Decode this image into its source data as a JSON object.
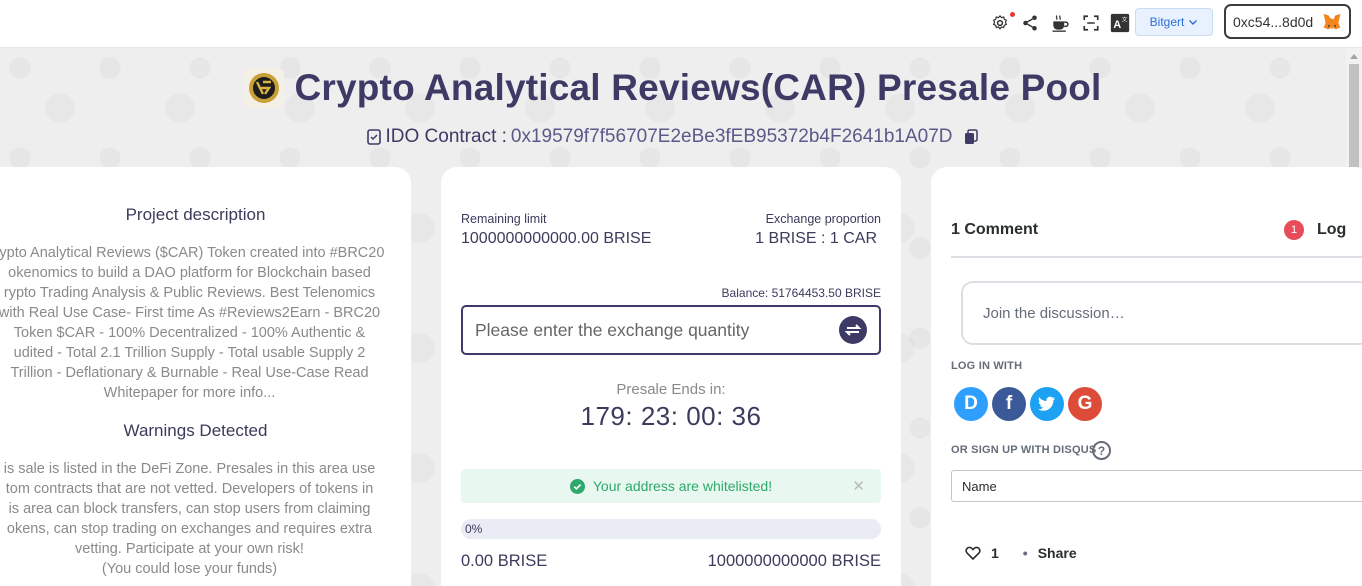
{
  "topbar": {
    "network_label": "Bitgert",
    "wallet_address": "0xc54...8d0d"
  },
  "header": {
    "title": "Crypto Analytical Reviews(CAR) Presale Pool",
    "contract_label": "IDO Contract : ",
    "contract_address": "0x19579f7f56707E2eBe3fEB95372b4F2641b1A07D"
  },
  "left_card": {
    "description_heading": "Project description",
    "description_lines": [
      "rypto Analytical Reviews ($CAR) Token created into #BRC20",
      "okenomics to build a DAO platform for Blockchain based",
      "rypto Trading Analysis & Public Reviews. Best Telenomics",
      "with Real Use Case- First time As #Reviews2Earn - BRC20",
      "Token $CAR - 100% Decentralized - 100% Authentic &",
      "udited - Total 2.1 Trillion Supply - Total usable Supply 2",
      "Trillion - Deflationary & Burnable - Real Use-Case Read",
      "Whitepaper for more info..."
    ],
    "warnings_heading": "Warnings Detected",
    "warnings_lines": [
      "is sale is listed in the DeFi Zone. Presales in this area use",
      "tom contracts that are not vetted. Developers of tokens in",
      "is area can block transfers, can stop users from claiming",
      "okens, can stop trading on exchanges and requires extra",
      "vetting. Participate at your own risk!",
      "(You could lose your funds)"
    ]
  },
  "mid_card": {
    "remaining_limit_label": "Remaining limit",
    "remaining_limit_value": "1000000000000.00 BRISE",
    "exchange_proportion_label": "Exchange proportion",
    "exchange_proportion_value": "1 BRISE : 1 CAR",
    "balance": "Balance: 51764453.50 BRISE",
    "exchange_placeholder": "Please enter the exchange quantity",
    "presale_ends_label": "Presale Ends in:",
    "countdown": "179: 23: 00: 36",
    "whitelist_message": "Your address are whitelisted!",
    "progress_text": "0%",
    "progress_fraction": 0,
    "raised_value": "0.00 BRISE",
    "cap_value": "1000000000000 BRISE"
  },
  "right_card": {
    "comments_title": "1 Comment",
    "notification_count": "1",
    "login_label": "Log",
    "join_placeholder": "Join the discussion…",
    "login_with_label": "LOG IN WITH",
    "social_logins": [
      "disqus",
      "facebook",
      "twitter",
      "google"
    ],
    "signup_label": "OR SIGN UP WITH DISQUS",
    "help_glyph": "?",
    "name_placeholder": "Name",
    "vote_count": "1",
    "share_label": "Share"
  },
  "colors": {
    "primary": "#3d3a66",
    "success": "#2ea86b",
    "facebook": "#3b5998",
    "twitter": "#1da1f2",
    "google": "#dd4b39",
    "disqus": "#2e9fff",
    "badge": "#e84c5a"
  }
}
